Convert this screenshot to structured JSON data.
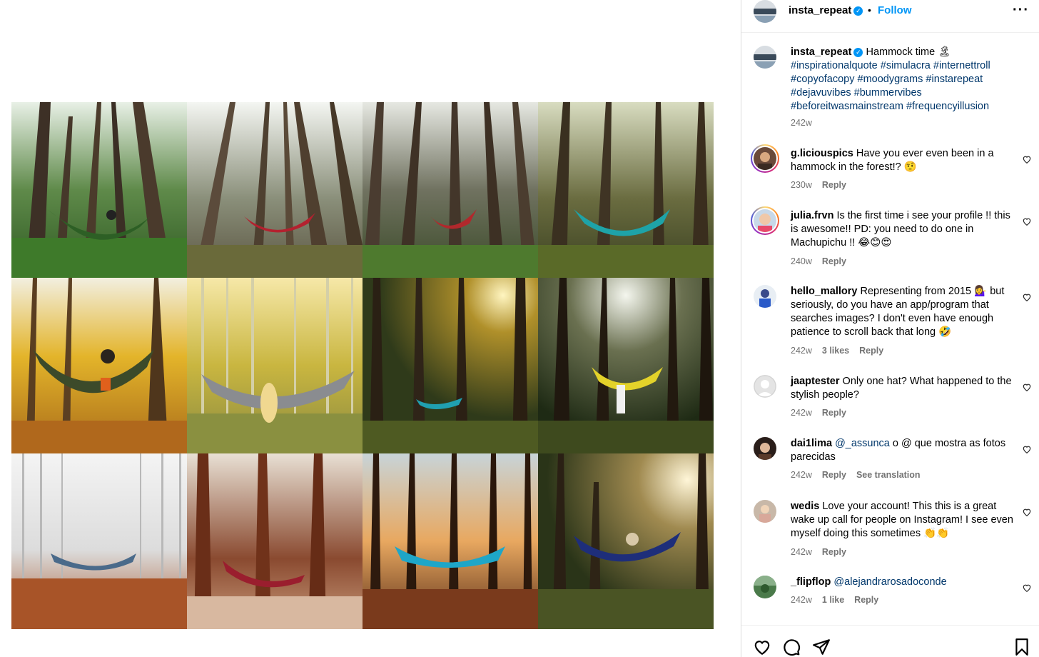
{
  "post": {
    "media_alt_tiles": [
      "forest-hammock-green",
      "forest-hammock-red",
      "forest-hammock-red-tall",
      "forest-hammock-teal",
      "yellow-forest-hammock-green",
      "aspen-hammock-grey",
      "sunlit-forest-hammock-blue",
      "sunrays-hammock-yellow",
      "foggy-forest-hammock-blue",
      "redwood-hammock-red",
      "sunset-forest-hammock-blue",
      "meadow-hammock-blue"
    ]
  },
  "header": {
    "username": "insta_repeat",
    "separator": "•",
    "follow_label": "Follow",
    "more_label": "···"
  },
  "caption": {
    "username": "insta_repeat",
    "text": "Hammock time 🏝",
    "hashtags": "#inspirationalquote #simulacra #internettroll #copyofacopy #moodygrams #instarepeat #dejavuvibes #bummervibes #beforeitwasmainstream #frequencyillusion",
    "time": "242w"
  },
  "comments": [
    {
      "username": "g.liciouspics",
      "text": "Have you ever even been in a hammock in the forest!? 🤨",
      "time": "230w",
      "likes": "",
      "reply": "Reply",
      "extra": ""
    },
    {
      "username": "julia.frvn",
      "text": "Is the first time i see your profile !! this is awesome!! PD: you need to do one in Machupichu !! 😂😊😍",
      "time": "240w",
      "likes": "",
      "reply": "Reply",
      "extra": ""
    },
    {
      "username": "hello_mallory",
      "text": "Representing from 2015 💁‍♀️ but seriously, do you have an app/program that searches images? I don't even have enough patience to scroll back that long 🤣",
      "time": "242w",
      "likes": "3 likes",
      "reply": "Reply",
      "extra": ""
    },
    {
      "username": "jaaptester",
      "text": "Only one hat? What happened to the stylish people?",
      "time": "242w",
      "likes": "",
      "reply": "Reply",
      "extra": ""
    },
    {
      "username": "dai1lima",
      "mention": "@_assunca",
      "text": "o @ que mostra as fotos parecidas",
      "time": "242w",
      "likes": "",
      "reply": "Reply",
      "extra": "See translation"
    },
    {
      "username": "wedis",
      "text": "Love your account! This this is a great wake up call for people on Instagram! I see even myself doing this sometimes 👏👏",
      "time": "242w",
      "likes": "",
      "reply": "Reply",
      "extra": ""
    },
    {
      "username": "_flipflop",
      "mention": "@alejandrarosadoconde",
      "text": "",
      "time": "242w",
      "likes": "1 like",
      "reply": "Reply",
      "extra": ""
    }
  ],
  "actions": {
    "like": "heart-icon",
    "comment": "comment-icon",
    "share": "share-icon",
    "save": "bookmark-icon"
  },
  "colors": {
    "link_blue": "#0095f6",
    "hashtag": "#00376b",
    "meta_grey": "#737373"
  }
}
